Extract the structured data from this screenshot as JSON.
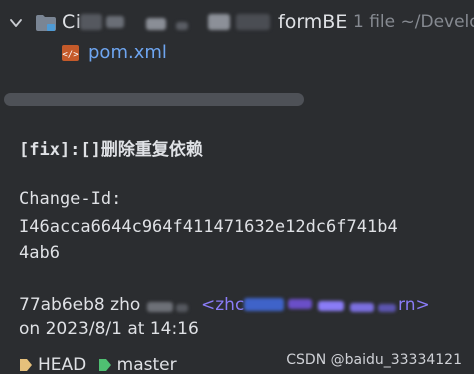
{
  "tree": {
    "module": {
      "name": "Ci",
      "name_suffix": "formBE",
      "hint": "1 file  ~/Develo"
    },
    "file": {
      "name": "pom.xml"
    }
  },
  "commit": {
    "title": "[fix]:[]删除重复依赖",
    "change_id_label": "Change-Id:",
    "change_id_line1": "I46acca6644c964f411471632e12dc6f741b4",
    "change_id_line2": "4ab6",
    "hash": "77ab6eb8",
    "author": "zho",
    "email_start": "<zhc",
    "email_end": "rn>",
    "date": "on 2023/8/1 at 14:16",
    "refs": [
      {
        "label": "HEAD",
        "icon": "tag-icon",
        "color": "#e5c07b"
      },
      {
        "label": "master",
        "icon": "branch-tag-icon",
        "color": "#4fbf72"
      }
    ]
  },
  "watermark": "CSDN @baidu_33334121",
  "colors": {
    "background": "#2b2d30",
    "text": "#dfe1e5",
    "muted": "#868a91",
    "link": "#6ea5f0",
    "email": "#8a7cf7",
    "head_tag": "#e5c07b",
    "branch_tag": "#4fbf72"
  }
}
